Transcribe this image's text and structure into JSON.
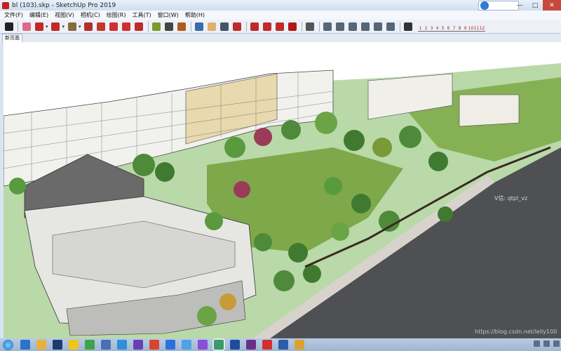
{
  "window": {
    "title": "bl (103).skp - SketchUp Pro 2019",
    "controls": {
      "minimize": "—",
      "maximize": "□",
      "close": "✕"
    }
  },
  "menu": {
    "items": [
      {
        "label": "文件(F)"
      },
      {
        "label": "编辑(E)"
      },
      {
        "label": "视图(V)"
      },
      {
        "label": "相机(C)"
      },
      {
        "label": "绘图(R)"
      },
      {
        "label": "工具(T)"
      },
      {
        "label": "窗口(W)"
      },
      {
        "label": "帮助(H)"
      }
    ]
  },
  "toolbar": {
    "tools": [
      {
        "name": "select-tool",
        "icon": "arrow-icon",
        "color": "#222222"
      },
      {
        "name": "eraser-tool",
        "icon": "eraser-icon",
        "color": "#e06a8a"
      },
      {
        "name": "line-tool",
        "icon": "pencil-icon",
        "color": "#c02a2a"
      },
      {
        "name": "arc-tool",
        "icon": "arc-icon",
        "color": "#c02a2a"
      },
      {
        "name": "shape-tool",
        "icon": "rectangle-icon",
        "color": "#8a6a3a"
      },
      {
        "name": "push-pull-tool",
        "icon": "push-pull-icon",
        "color": "#b0312d"
      },
      {
        "name": "offset-tool",
        "icon": "offset-icon",
        "color": "#c0392b"
      },
      {
        "name": "move-tool",
        "icon": "move-icon",
        "color": "#d03030"
      },
      {
        "name": "rotate-tool",
        "icon": "rotate-icon",
        "color": "#d03030"
      },
      {
        "name": "scale-tool",
        "icon": "scale-icon",
        "color": "#c02a2a"
      },
      {
        "name": "tape-measure-tool",
        "icon": "tape-icon",
        "color": "#7a9a2a"
      },
      {
        "name": "text-tool",
        "icon": "text-icon",
        "color": "#444444"
      },
      {
        "name": "paint-bucket-tool",
        "icon": "paint-bucket-icon",
        "color": "#b05a20"
      },
      {
        "name": "orbit-tool",
        "icon": "orbit-icon",
        "color": "#3a6ab0"
      },
      {
        "name": "pan-tool",
        "icon": "hand-icon",
        "color": "#e0b070"
      },
      {
        "name": "zoom-tool",
        "icon": "magnifier-icon",
        "color": "#445566"
      },
      {
        "name": "zoom-extents-tool",
        "icon": "zoom-extents-icon",
        "color": "#c02a2a"
      },
      {
        "name": "warehouse-tool",
        "icon": "warehouse-icon",
        "color": "#c02a2a"
      },
      {
        "name": "extension-warehouse-tool",
        "icon": "extension-icon",
        "color": "#c02a2a"
      },
      {
        "name": "layout-tool",
        "icon": "layout-icon",
        "color": "#c02a2a"
      },
      {
        "name": "ruby-tool",
        "icon": "ruby-icon",
        "color": "#b01818"
      },
      {
        "name": "account-tool",
        "icon": "user-icon",
        "color": "#555555"
      },
      {
        "name": "iso-view",
        "icon": "iso-view-icon",
        "color": "#556677"
      },
      {
        "name": "top-view",
        "icon": "top-view-icon",
        "color": "#556677"
      },
      {
        "name": "front-view",
        "icon": "front-view-icon",
        "color": "#556677"
      },
      {
        "name": "right-view",
        "icon": "right-view-icon",
        "color": "#556677"
      },
      {
        "name": "back-view",
        "icon": "back-view-icon",
        "color": "#556677"
      },
      {
        "name": "left-view",
        "icon": "left-view-icon",
        "color": "#556677"
      },
      {
        "name": "style-tool",
        "icon": "style-icon",
        "color": "#333333"
      }
    ],
    "ruler_numbers": [
      "1",
      "2",
      "3",
      "4",
      "5",
      "6",
      "7",
      "8",
      "9",
      "10",
      "11",
      "12"
    ]
  },
  "scenes": {
    "tabs": [
      {
        "label": "新页面"
      }
    ]
  },
  "viewport": {
    "watermark": "V信: qtpl_vz",
    "url_watermark": "https://blog.csdn.net/lelly100"
  },
  "taskbar": {
    "apps": [
      {
        "name": "ie-taskbar-icon",
        "color": "#2b74c9"
      },
      {
        "name": "explorer-taskbar-icon",
        "color": "#e8b23a"
      },
      {
        "name": "ps-taskbar-icon",
        "color": "#1c3b6e"
      },
      {
        "name": "chrome-taskbar-icon",
        "color": "#f0c419"
      },
      {
        "name": "app-taskbar-icon",
        "color": "#3fa34d"
      },
      {
        "name": "app2-taskbar-icon",
        "color": "#4b6fb5"
      },
      {
        "name": "app3-taskbar-icon",
        "color": "#2f8fd8"
      },
      {
        "name": "app4-taskbar-icon",
        "color": "#6a3fb5"
      },
      {
        "name": "app5-taskbar-icon",
        "color": "#d8452f"
      },
      {
        "name": "app6-taskbar-icon",
        "color": "#2f6fd8"
      },
      {
        "name": "app7-taskbar-icon",
        "color": "#4fa3e0"
      },
      {
        "name": "app8-taskbar-icon",
        "color": "#8a4fd8"
      },
      {
        "name": "app9-taskbar-icon",
        "color": "#3a9a6a"
      },
      {
        "name": "app10-taskbar-icon",
        "color": "#1c4ea0"
      },
      {
        "name": "app11-taskbar-icon",
        "color": "#6a2f8a"
      },
      {
        "name": "app12-taskbar-icon",
        "color": "#d03030"
      },
      {
        "name": "app13-taskbar-icon",
        "color": "#2a5ea8"
      },
      {
        "name": "app14-taskbar-icon",
        "color": "#d8a42f"
      }
    ]
  }
}
